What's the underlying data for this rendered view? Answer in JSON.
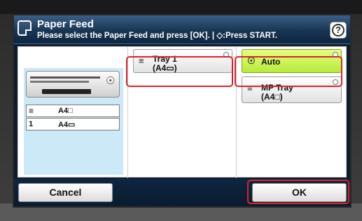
{
  "header": {
    "title": "Paper Feed",
    "subtitle": "Please select the Paper Feed and press [OK]. | ◇:Press START.",
    "help_label": "?"
  },
  "machine_preview": {
    "rows": [
      {
        "icon": "≡",
        "label": "A4□"
      },
      {
        "icon": "1",
        "label": "A4▭"
      }
    ]
  },
  "options": {
    "tray1": {
      "line1": "Tray 1",
      "line2": "(A4▭)",
      "selected": false
    },
    "auto": {
      "line1": "Auto",
      "selected": true
    },
    "mp_tray": {
      "line1": "MP Tray",
      "line2": "(A4□)",
      "selected": false
    }
  },
  "footer": {
    "cancel_label": "Cancel",
    "ok_label": "OK"
  },
  "colors": {
    "header_bg": "#173553",
    "selected_bg": "#b8ea3a",
    "highlight": "#d9252a",
    "preview_bg": "#cce9f7"
  }
}
